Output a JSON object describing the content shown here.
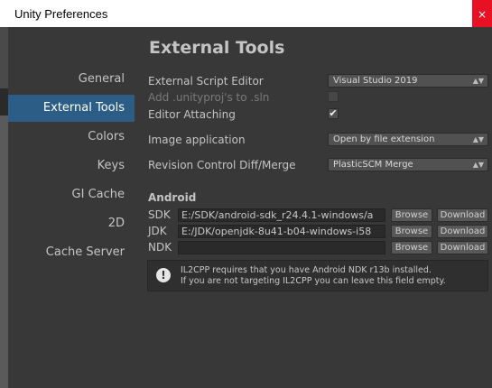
{
  "window": {
    "title": "Unity Preferences",
    "close_glyph": "×",
    "close_icon": "close-icon"
  },
  "sidebar": {
    "items": [
      {
        "label": "General"
      },
      {
        "label": "External Tools",
        "selected": true
      },
      {
        "label": "Colors"
      },
      {
        "label": "Keys"
      },
      {
        "label": "GI Cache"
      },
      {
        "label": "2D"
      },
      {
        "label": "Cache Server"
      }
    ],
    "selected_color": "#2c5d87"
  },
  "main": {
    "heading": "External Tools",
    "external_script_editor": {
      "label": "External Script Editor",
      "value": "Visual Studio 2019"
    },
    "add_unityproj": {
      "label": "Add .unityproj's to .sln",
      "checked": false,
      "enabled": false
    },
    "editor_attaching": {
      "label": "Editor Attaching",
      "checked": true,
      "check_glyph": "✔"
    },
    "image_application": {
      "label": "Image application",
      "value": "Open by file extension"
    },
    "revision_control": {
      "label": "Revision Control Diff/Merge",
      "value": "PlasticSCM Merge"
    },
    "dropdown_arrow": "▲▼"
  },
  "android": {
    "section_label": "Android",
    "sdk": {
      "label": "SDK",
      "value": "E:/SDK/android-sdk_r24.4.1-windows/a"
    },
    "jdk": {
      "label": "JDK",
      "value": "E:/JDK/openjdk-8u41-b04-windows-i58"
    },
    "ndk": {
      "label": "NDK",
      "value": ""
    },
    "browse_label": "Browse",
    "download_label": "Download",
    "help": {
      "icon": "warning-icon",
      "icon_glyph": "!",
      "line1": "IL2CPP requires that you have Android NDK r13b installed.",
      "line2": "If you are not targeting IL2CPP you can leave this field empty."
    }
  }
}
